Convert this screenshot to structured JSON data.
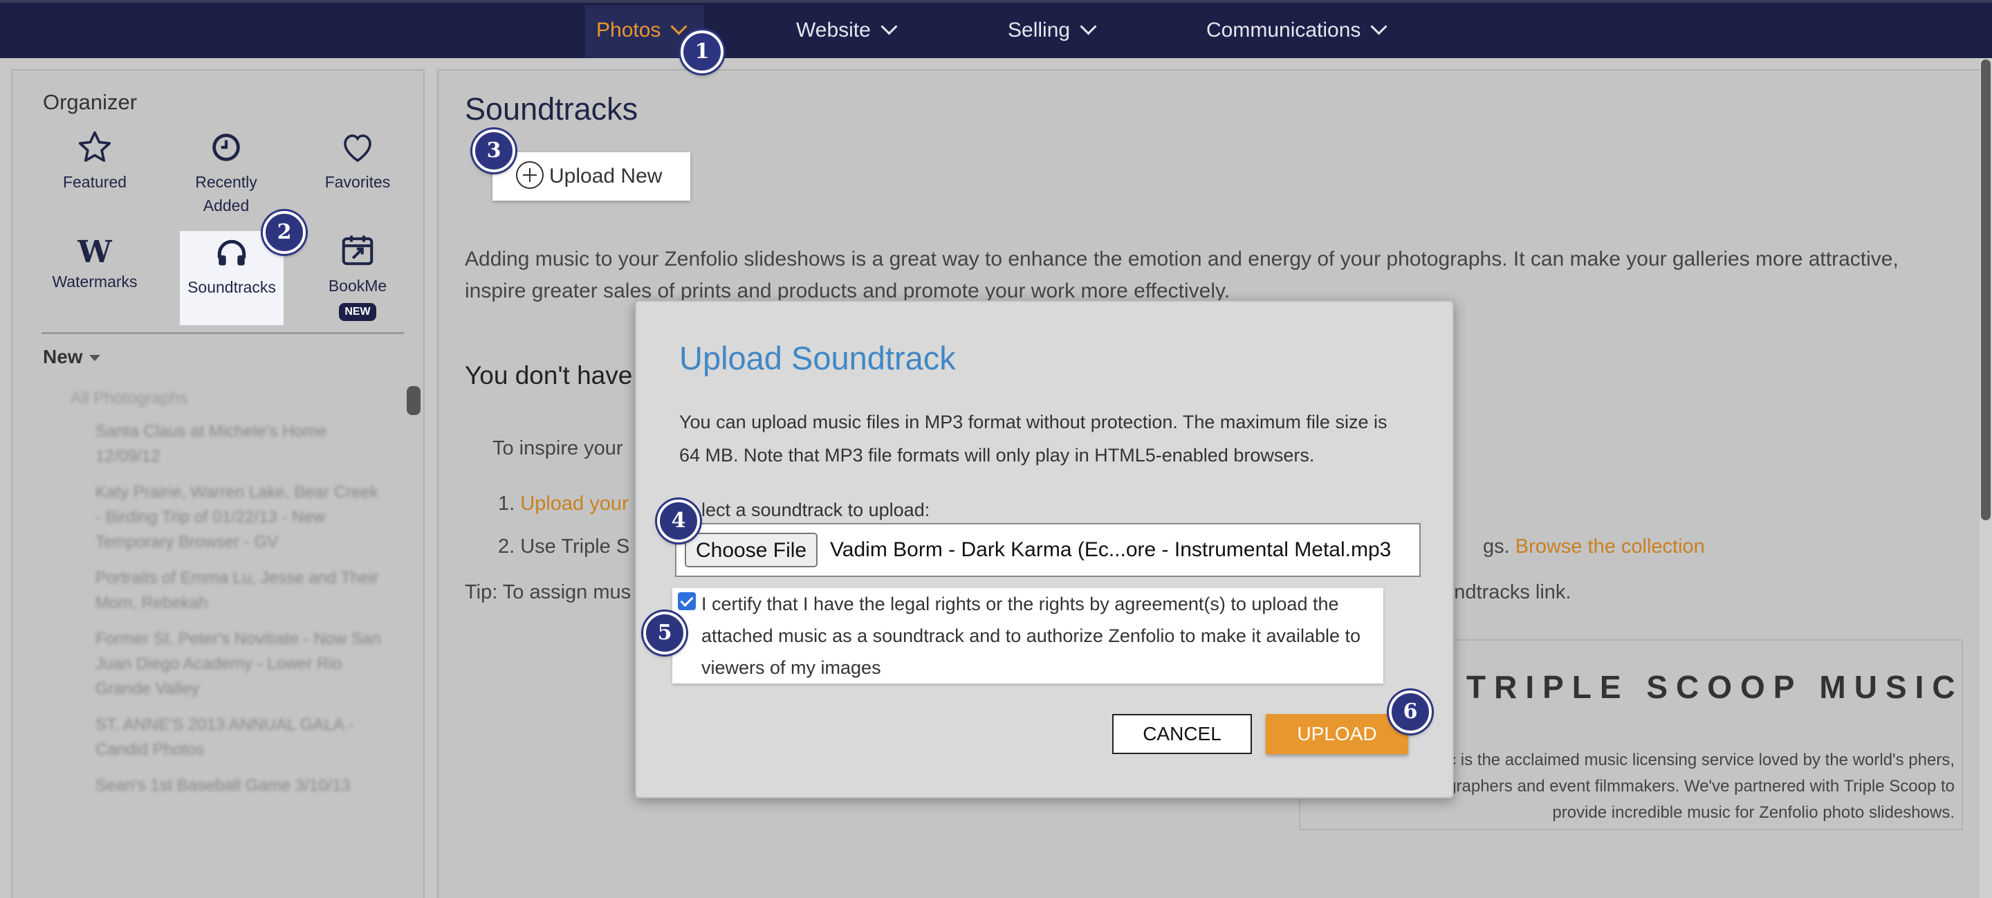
{
  "nav": {
    "items": [
      {
        "label": "Photos",
        "color": "#e8962e"
      },
      {
        "label": "Website"
      },
      {
        "label": "Selling"
      },
      {
        "label": "Communications"
      }
    ]
  },
  "badges": [
    "1",
    "2",
    "3",
    "4",
    "5",
    "6"
  ],
  "sidebar": {
    "title": "Organizer",
    "tiles": [
      {
        "label": "Featured",
        "icon": "star-icon"
      },
      {
        "label": "Recently Added",
        "icon": "clock-icon"
      },
      {
        "label": "Favorites",
        "icon": "heart-icon"
      },
      {
        "label": "Watermarks",
        "icon": "watermark-w-icon"
      },
      {
        "label": "Soundtracks",
        "icon": "headphones-icon"
      },
      {
        "label": "BookMe",
        "icon": "calendar-icon",
        "tag": "NEW"
      }
    ],
    "new_label": "New",
    "tree_root": "All Photographs",
    "tree_items": [
      "Santa Claus at Michele's Home 12/09/12",
      "Katy Prairie, Warren Lake, Bear Creek - Birding Trip of 01/22/13 - New Temporary Browser - GV",
      "Portraits of Emma Lu, Jesse and Their Mom, Rebekah",
      "Former St. Peter's Novitiate - Now San Juan Diego Academy - Lower Rio Grande Valley",
      "ST. ANNE'S 2013 ANNUAL GALA - Candid Photos",
      "Sean's 1st Baseball Game 3/10/13"
    ]
  },
  "main": {
    "title": "Soundtracks",
    "upload_new": "Upload New",
    "intro": "Adding music to your Zenfolio slideshows is a great way to enhance the emotion and energy of your photographs. It can make your galleries more attractive, inspire greater sales of prints and products and promote your work more effectively.",
    "none_heading": "You don't have",
    "inspire": "To inspire your",
    "step1_num": "1.",
    "step1_link": "Upload your",
    "step2": "2. Use Triple S",
    "step2_tail": "gs.",
    "browse_link": "Browse the collection",
    "tip": "Tip: To assign mus",
    "tip_tail": "oundtracks link.",
    "triple_scoop_logo": "TRIPLE SCOOP MUSIC",
    "triple_scoop_text": "usic is the acclaimed music licensing service loved by the world's phers, videographers and event filmmakers. We've partnered with Triple Scoop to provide incredible music for Zenfolio photo slideshows."
  },
  "modal": {
    "title": "Upload Soundtrack",
    "description": "You can upload music files in MP3 format without protection. The maximum file size is 64 MB. Note that MP3 file formats will only play in HTML5-enabled browsers.",
    "select_label": "lect a soundtrack to upload:",
    "choose_file": "Choose File",
    "file_name": "Vadim Borm - Dark Karma (Ec...ore - Instrumental Metal.mp3",
    "certify_checked": true,
    "certify_text": "I certify that I have the legal rights or the rights by agreement(s) to upload the attached music as a soundtrack and to authorize Zenfolio to make it available to viewers of my images",
    "cancel": "CANCEL",
    "upload": "UPLOAD"
  },
  "colors": {
    "nav_bg": "#1c2047",
    "accent_orange": "#e8962e",
    "title_blue": "#3f88c5",
    "badge": "#2e3580"
  }
}
